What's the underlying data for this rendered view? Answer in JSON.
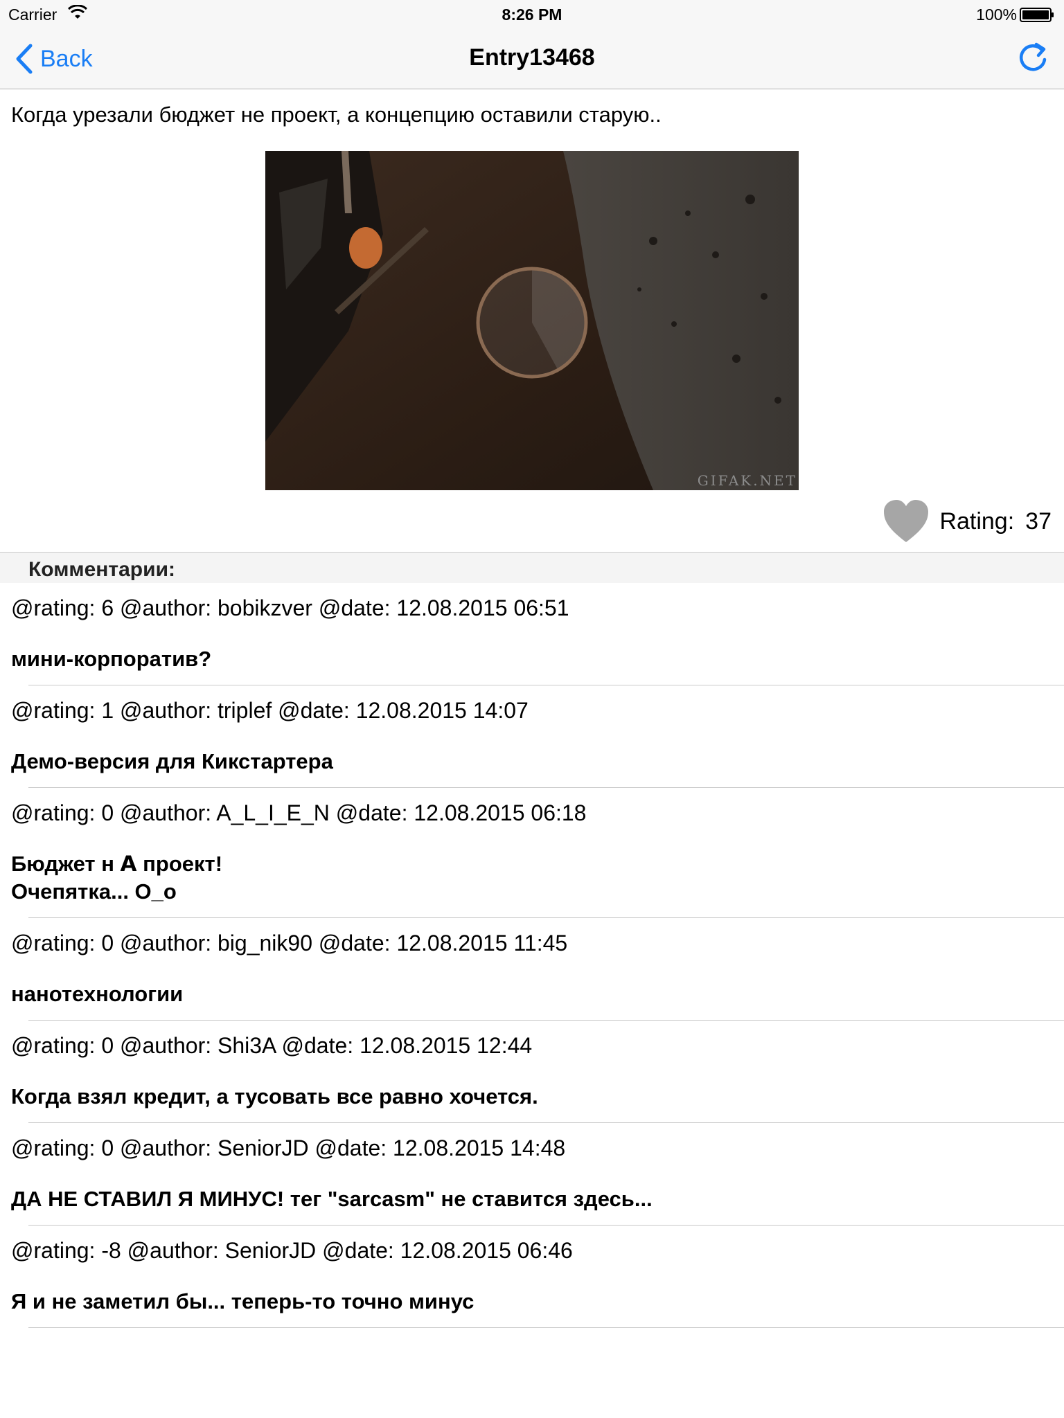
{
  "status_bar": {
    "carrier": "Carrier",
    "time": "8:26 PM",
    "battery": "100%"
  },
  "nav": {
    "back_label": "Back",
    "title": "Entry13468",
    "refresh_icon": "refresh-icon"
  },
  "post": {
    "text": "Когда урезали бюджет не проект, а концепцию оставили старую..",
    "watermark": "GIFAK.NET",
    "rating_label": "Rating:",
    "rating_value": "37",
    "progress": 0.42
  },
  "comments_header": "Комментарии:",
  "comments": [
    {
      "meta": "@rating: 6 @author: bobikzver @date: 12.08.2015 06:51",
      "body": "мини-корпоратив?"
    },
    {
      "meta": "@rating: 1 @author: triplef @date: 12.08.2015 14:07",
      "body": "Демо-версия для Кикстартера"
    },
    {
      "meta": "@rating: 0 @author: A_L_I_E_N @date: 12.08.2015 06:18",
      "body": "Бюджет н 𝗔 проект!\nОчепятка... О_о"
    },
    {
      "meta": "@rating: 0 @author: big_nik90 @date: 12.08.2015 11:45",
      "body": "нанотехнологии"
    },
    {
      "meta": "@rating: 0 @author: Shi3A @date: 12.08.2015 12:44",
      "body": "Когда взял кредит, а тусовать все равно хочется."
    },
    {
      "meta": "@rating: 0 @author: SeniorJD @date: 12.08.2015 14:48",
      "body": "ДА НЕ СТАВИЛ Я МИНУС! тег \"sarcasm\" не ставится здесь..."
    },
    {
      "meta": "@rating: -8 @author: SeniorJD @date: 12.08.2015 06:46",
      "body": "Я и не заметил бы... теперь-то точно минус"
    }
  ],
  "colors": {
    "accent": "#1a7ef5",
    "heart": "#a6a6a6"
  }
}
